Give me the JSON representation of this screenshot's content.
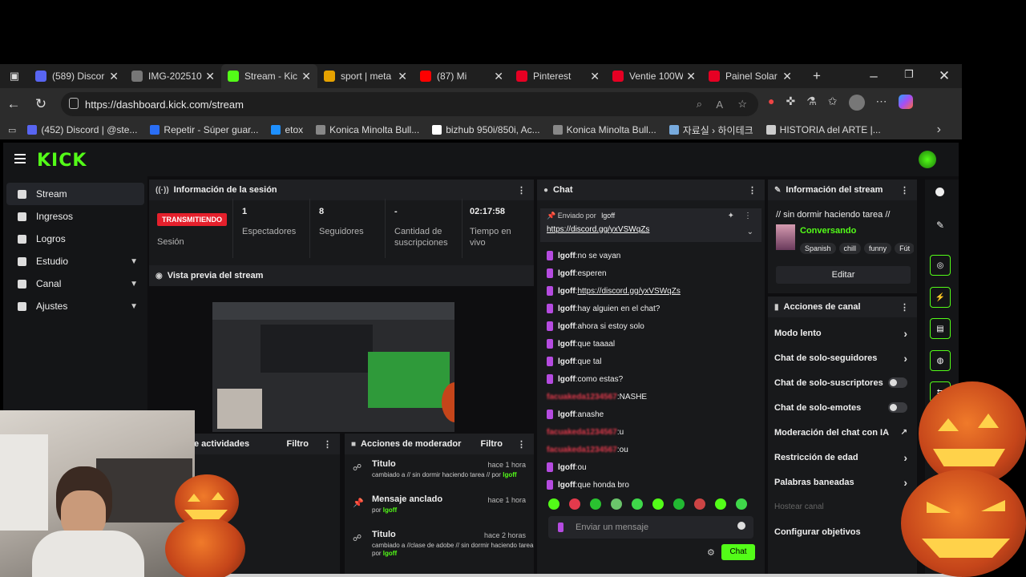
{
  "browser": {
    "tabs": [
      {
        "label": "(589) Discor",
        "color": "#5865f2"
      },
      {
        "label": "IMG-202510",
        "color": "#777"
      },
      {
        "label": "Stream - Kic",
        "color": "#53fc18"
      },
      {
        "label": "sport | meta",
        "color": "#e6a200"
      },
      {
        "label": "(87) Mi",
        "color": "#ff0000"
      },
      {
        "label": "Pinterest",
        "color": "#e60023"
      },
      {
        "label": "Ventie 100W",
        "color": "#e60023"
      },
      {
        "label": "Painel Solar",
        "color": "#e60023"
      }
    ],
    "url": "https://dashboard.kick.com/stream",
    "bookmarks": [
      "(452) Discord | @ste...",
      "Repetir - Súper guar...",
      "etox",
      "Konica Minolta Bull...",
      "bizhub 950i/850i, Ac...",
      "Konica Minolta Bull...",
      "자료실 › 하이테크",
      "HISTORIA del ARTE |..."
    ]
  },
  "sidebar": {
    "items": [
      {
        "label": "Stream",
        "active": true,
        "chevron": false
      },
      {
        "label": "Ingresos",
        "chevron": false
      },
      {
        "label": "Logros",
        "chevron": false
      },
      {
        "label": "Estudio",
        "chevron": true
      },
      {
        "label": "Canal",
        "chevron": true
      },
      {
        "label": "Ajustes",
        "chevron": true
      }
    ]
  },
  "session": {
    "title": "Información de la sesión",
    "badge": "TRANSMITIENDO",
    "session_label": "Sesión",
    "stats": [
      {
        "value": "1",
        "label": "Espectadores"
      },
      {
        "value": "8",
        "label": "Seguidores"
      },
      {
        "value": "-",
        "label": "Cantidad de suscripciones"
      },
      {
        "value": "02:17:58",
        "label": "Tiempo en vivo"
      }
    ]
  },
  "preview": {
    "title": "Vista previa del stream"
  },
  "activity": {
    "title": "e actividades",
    "filter": "Filtro"
  },
  "modactions": {
    "title": "Acciones de moderador",
    "filter": "Filtro",
    "items": [
      {
        "title": "Titulo",
        "time": "hace 1 hora",
        "detail": "cambiado a // sin dormir haciendo tarea // por",
        "user": "lgoff"
      },
      {
        "title": "Mensaje anclado",
        "time": "hace 1 hora",
        "detail": "por",
        "user": "lgoff"
      },
      {
        "title": "Titulo",
        "time": "hace 2 horas",
        "detail": "cambiado a //clase de adobe // sin dormir haciendo tarea por",
        "user": "lgoff"
      }
    ]
  },
  "chat": {
    "title": "Chat",
    "pinned_by": "Enviado por",
    "pinned_user": "lgoff",
    "pinned_link": "https://discord.gg/yxVSWqZs",
    "messages": [
      {
        "user": "lgoff",
        "text": "no se vayan"
      },
      {
        "user": "lgoff",
        "text": "esperen"
      },
      {
        "user": "lgoff",
        "text": "https://discord.gg/yxVSWqZs",
        "link": true
      },
      {
        "user": "lgoff",
        "text": "hay alguien en el chat?"
      },
      {
        "user": "lgoff",
        "text": "ahora si estoy solo"
      },
      {
        "user": "lgoff",
        "text": "que taaaal"
      },
      {
        "user": "lgoff",
        "text": "que tal"
      },
      {
        "user": "lgoff",
        "text": "como estas?"
      },
      {
        "user": "facuakeda1234567",
        "text": "NASHE",
        "red": true
      },
      {
        "user": "lgoff",
        "text": "anashe"
      },
      {
        "user": "facuakeda1234567",
        "text": "u",
        "red": true
      },
      {
        "user": "facuakeda1234567",
        "text": "ou",
        "red": true
      },
      {
        "user": "lgoff",
        "text": "ou"
      },
      {
        "user": "lgoff",
        "text": "que honda bro"
      }
    ],
    "input_placeholder": "Enviar un mensaje",
    "send_label": "Chat"
  },
  "streaminfo": {
    "title": "Información del stream",
    "stream_title": "// sin dormir haciendo tarea //",
    "category": "Conversando",
    "tags": [
      "Spanish",
      "chill",
      "funny",
      "Fút"
    ],
    "edit_label": "Editar"
  },
  "channelactions": {
    "title": "Acciones de canal",
    "items": [
      {
        "label": "Modo lento",
        "control": "arrow"
      },
      {
        "label": "Chat de solo-seguidores",
        "control": "arrow"
      },
      {
        "label": "Chat de solo-suscriptores",
        "control": "toggle"
      },
      {
        "label": "Chat de solo-emotes",
        "control": "toggle"
      },
      {
        "label": "Moderación del chat con IA",
        "control": "ext"
      },
      {
        "label": "Restricción de edad",
        "control": "arrow"
      },
      {
        "label": "Palabras baneadas",
        "control": "arrow"
      },
      {
        "label": "Hostear canal",
        "control": "none",
        "disabled": true
      },
      {
        "label": "Configurar objetivos",
        "control": "none"
      }
    ]
  },
  "colors": {
    "accent": "#53fc18",
    "live": "#e5202c",
    "bg": "#0e0e10",
    "panel": "#18191b"
  }
}
